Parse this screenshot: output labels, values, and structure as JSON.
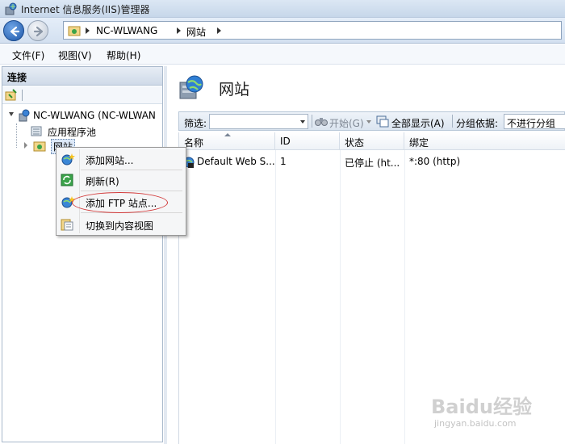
{
  "window": {
    "title": "Internet 信息服务(IIS)管理器"
  },
  "address": {
    "crumbs": [
      "NC-WLWANG",
      "网站"
    ]
  },
  "menubar": {
    "items": [
      "文件(F)",
      "视图(V)",
      "帮助(H)"
    ]
  },
  "connections": {
    "header": "连接",
    "tree": {
      "server": "NC-WLWANG (NC-WLWAN",
      "app_pools": "应用程序池",
      "sites": "网站"
    }
  },
  "context_menu": {
    "items": [
      "添加网站...",
      "刷新(R)",
      "添加 FTP 站点...",
      "切换到内容视图"
    ]
  },
  "main": {
    "heading": "网站",
    "filter_label": "筛选:",
    "filter_value": "",
    "start_label": "开始(G)",
    "show_all_label": "全部显示(A)",
    "group_by_label": "分组依据:",
    "group_by_value": "不进行分组",
    "columns": [
      "名称",
      "ID",
      "状态",
      "绑定"
    ],
    "rows": [
      {
        "name": "Default Web S...",
        "id": "1",
        "status": "已停止 (ht...",
        "binding": "*:80 (http)"
      }
    ]
  },
  "watermark": {
    "text": "Baidu经验",
    "sub": "jingyan.baidu.com"
  },
  "colors": {
    "accent": "#1e57a8",
    "highlight_ellipse": "#d23a3a"
  }
}
